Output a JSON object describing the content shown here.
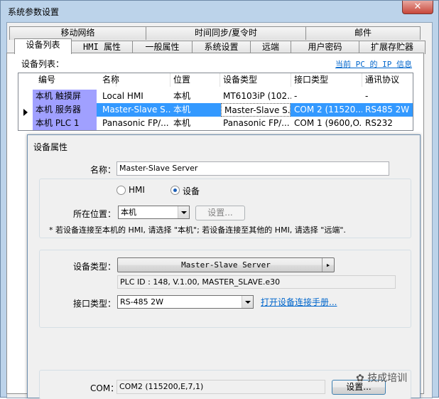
{
  "window": {
    "title": "系统参数设置",
    "close_label": "✕"
  },
  "tabs_row1": [
    "移动网络",
    "时间同步/夏令时",
    "邮件"
  ],
  "tabs_row2": [
    "设备列表",
    "HMI 属性",
    "一般属性",
    "系统设置",
    "远端",
    "用户密码",
    "扩展存贮器"
  ],
  "device_list": {
    "label": "设备列表：",
    "ip_link": "当前 PC 的 IP 信息",
    "columns": [
      "编号",
      "名称",
      "位置",
      "设备类型",
      "接口类型",
      "通讯协议"
    ],
    "rows": [
      {
        "id": "本机 触摸屏",
        "name": "Local HMI",
        "location": "本机",
        "type": "MT6103iP (102...",
        "interface": "-",
        "protocol": "-"
      },
      {
        "id": "本机 服务器",
        "name": "Master-Slave S...",
        "location": "本机",
        "type": "Master-Slave S...",
        "interface": "COM 2 (11520...",
        "protocol": "RS485 2W"
      },
      {
        "id": "本机 PLC 1",
        "name": "Panasonic FP/...",
        "location": "本机",
        "type": "Panasonic FP/...",
        "interface": "COM 1 (9600,O...",
        "protocol": "RS232"
      }
    ]
  },
  "dialog": {
    "title": "设备属性",
    "name_label": "名称：",
    "name_value": "Master-Slave Server",
    "radio_hmi": "HMI",
    "radio_device": "设备",
    "location_label": "所在位置：",
    "location_value": "本机",
    "settings_button": "设置...",
    "note": "* 若设备连接至本机的 HMI, 请选择 \"本机\"; 若设备连接至其他的 HMI, 请选择 \"远端\".",
    "device_type_label": "设备类型：",
    "device_type_value": "Master-Slave Server",
    "plc_info": "PLC ID : 148, V.1.00, MASTER_SLAVE.e30",
    "interface_label": "接口类型：",
    "interface_value": "RS-485 2W",
    "manual_link": "打开设备连接手册...",
    "com_label": "COM：",
    "com_value": "COM2 (115200,E,7,1)",
    "com_settings_button": "设置..."
  },
  "watermark": "技成培训",
  "colors": {
    "selection": "#3399ff",
    "purple_cell": "#a0a0ff",
    "frame": "#bcd3ea",
    "link": "#0066cc"
  }
}
